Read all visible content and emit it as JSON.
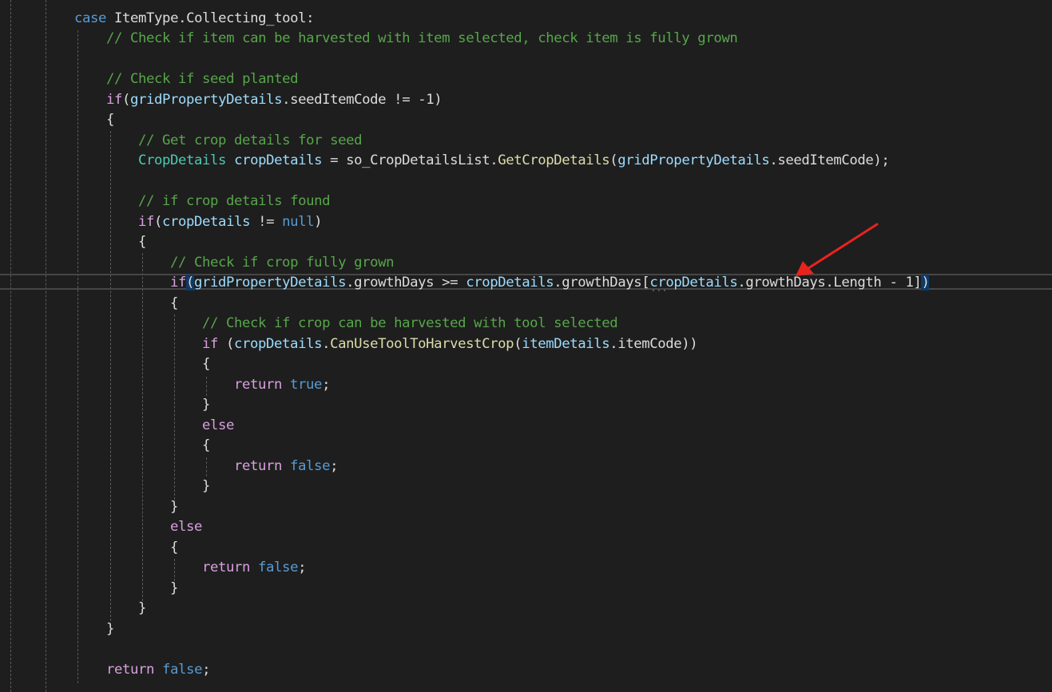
{
  "editor": {
    "accent_colors": {
      "keyword": "#569cd6",
      "control": "#d8a0df",
      "comment": "#57a64a",
      "type": "#4ec9b0",
      "variable": "#9cdcfe",
      "method": "#dcdcaa",
      "text": "#dcdcdc",
      "annotation_arrow": "#e8231e"
    },
    "annotation": {
      "icon": "red-arrow-icon"
    },
    "lines": [
      {
        "tokens": [
          {
            "t": "case",
            "c": "kw"
          },
          {
            "t": " ItemType.Collecting_tool:",
            "c": "prop"
          }
        ]
      },
      {
        "tokens": [
          {
            "t": "// Check if item can be harvested with item selected, check item is fully grown",
            "c": "cmt"
          }
        ]
      },
      {
        "tokens": [
          {
            "t": "// Check if seed planted",
            "c": "cmt"
          }
        ]
      },
      {
        "tokens": [
          {
            "t": "if",
            "c": "ctl"
          },
          {
            "t": "(",
            "c": "prop"
          },
          {
            "t": "gridPropertyDetails",
            "c": "var"
          },
          {
            "t": ".seedItemCode != -1)",
            "c": "prop"
          }
        ]
      },
      {
        "tokens": [
          {
            "t": "{",
            "c": "prop"
          }
        ]
      },
      {
        "tokens": [
          {
            "t": "// Get crop details for seed",
            "c": "cmt"
          }
        ]
      },
      {
        "tokens": [
          {
            "t": "CropDetails",
            "c": "type"
          },
          {
            "t": " ",
            "c": "prop"
          },
          {
            "t": "cropDetails",
            "c": "var"
          },
          {
            "t": " = so_CropDetailsList.",
            "c": "prop"
          },
          {
            "t": "GetCropDetails",
            "c": "fn"
          },
          {
            "t": "(",
            "c": "prop"
          },
          {
            "t": "gridPropertyDetails",
            "c": "var"
          },
          {
            "t": ".seedItemCode);",
            "c": "prop"
          }
        ]
      },
      {
        "tokens": [
          {
            "t": "// if crop details found",
            "c": "cmt"
          }
        ]
      },
      {
        "tokens": [
          {
            "t": "if",
            "c": "ctl"
          },
          {
            "t": "(",
            "c": "prop"
          },
          {
            "t": "cropDetails",
            "c": "var"
          },
          {
            "t": " != ",
            "c": "prop"
          },
          {
            "t": "null",
            "c": "kw"
          },
          {
            "t": ")",
            "c": "prop"
          }
        ]
      },
      {
        "tokens": [
          {
            "t": "{",
            "c": "prop"
          }
        ]
      },
      {
        "tokens": [
          {
            "t": "// Check if crop fully grown",
            "c": "cmt"
          }
        ]
      },
      {
        "tokens": [
          {
            "t": "if",
            "c": "ctl"
          },
          {
            "t": "(",
            "c": "prop brace-hl"
          },
          {
            "t": "gridPropertyDetails",
            "c": "var"
          },
          {
            "t": ".growthDays >= ",
            "c": "prop"
          },
          {
            "t": "cropDetails",
            "c": "var"
          },
          {
            "t": ".growthDays[",
            "c": "prop"
          },
          {
            "t": "cropDetails",
            "c": "var"
          },
          {
            "t": ".growthDays.Length - 1]",
            "c": "prop"
          },
          {
            "t": ")",
            "c": "prop brace-hl"
          }
        ]
      },
      {
        "tokens": [
          {
            "t": "{",
            "c": "prop"
          }
        ]
      },
      {
        "tokens": [
          {
            "t": "// Check if crop can be harvested with tool selected",
            "c": "cmt"
          }
        ]
      },
      {
        "tokens": [
          {
            "t": "if",
            "c": "ctl"
          },
          {
            "t": " (",
            "c": "prop"
          },
          {
            "t": "cropDetails",
            "c": "var"
          },
          {
            "t": ".",
            "c": "prop"
          },
          {
            "t": "CanUseToolToHarvestCrop",
            "c": "fn"
          },
          {
            "t": "(",
            "c": "prop"
          },
          {
            "t": "itemDetails",
            "c": "var"
          },
          {
            "t": ".itemCode))",
            "c": "prop"
          }
        ]
      },
      {
        "tokens": [
          {
            "t": "{",
            "c": "prop"
          }
        ]
      },
      {
        "tokens": [
          {
            "t": "return",
            "c": "ctl"
          },
          {
            "t": " ",
            "c": "prop"
          },
          {
            "t": "true",
            "c": "kw"
          },
          {
            "t": ";",
            "c": "prop"
          }
        ]
      },
      {
        "tokens": [
          {
            "t": "}",
            "c": "prop"
          }
        ]
      },
      {
        "tokens": [
          {
            "t": "else",
            "c": "ctl"
          }
        ]
      },
      {
        "tokens": [
          {
            "t": "{",
            "c": "prop"
          }
        ]
      },
      {
        "tokens": [
          {
            "t": "return",
            "c": "ctl"
          },
          {
            "t": " ",
            "c": "prop"
          },
          {
            "t": "false",
            "c": "kw"
          },
          {
            "t": ";",
            "c": "prop"
          }
        ]
      },
      {
        "tokens": [
          {
            "t": "}",
            "c": "prop"
          }
        ]
      },
      {
        "tokens": [
          {
            "t": "}",
            "c": "prop"
          }
        ]
      },
      {
        "tokens": [
          {
            "t": "else",
            "c": "ctl"
          }
        ]
      },
      {
        "tokens": [
          {
            "t": "{",
            "c": "prop"
          }
        ]
      },
      {
        "tokens": [
          {
            "t": "return",
            "c": "ctl"
          },
          {
            "t": " ",
            "c": "prop"
          },
          {
            "t": "false",
            "c": "kw"
          },
          {
            "t": ";",
            "c": "prop"
          }
        ]
      },
      {
        "tokens": [
          {
            "t": "}",
            "c": "prop"
          }
        ]
      },
      {
        "tokens": [
          {
            "t": "}",
            "c": "prop"
          }
        ]
      },
      {
        "tokens": [
          {
            "t": "}",
            "c": "prop"
          }
        ]
      },
      {
        "tokens": [
          {
            "t": "return",
            "c": "ctl"
          },
          {
            "t": " ",
            "c": "prop"
          },
          {
            "t": "false",
            "c": "kw"
          },
          {
            "t": ";",
            "c": "prop"
          }
        ]
      }
    ]
  }
}
